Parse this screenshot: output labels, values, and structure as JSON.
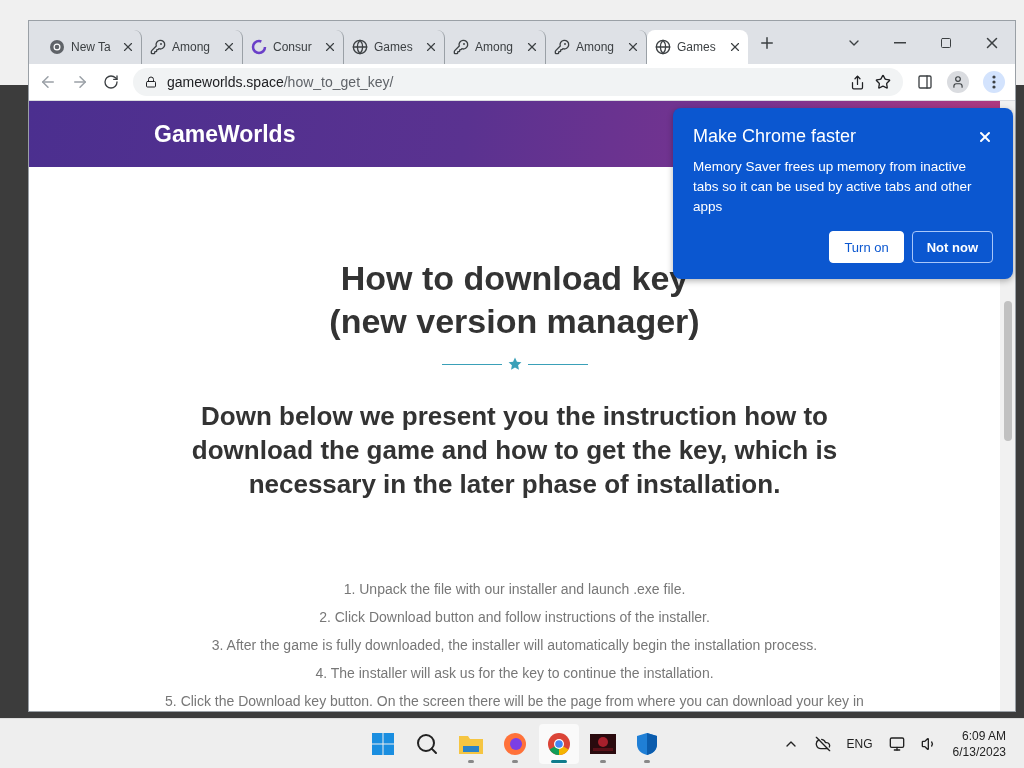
{
  "browser": {
    "tabs": [
      {
        "label": "New Ta",
        "kind": "chrome",
        "selected": false
      },
      {
        "label": "Among",
        "kind": "key",
        "selected": false
      },
      {
        "label": "Consur",
        "kind": "ring",
        "selected": false
      },
      {
        "label": "Games",
        "kind": "globe",
        "selected": false
      },
      {
        "label": "Among",
        "kind": "key",
        "selected": false
      },
      {
        "label": "Among",
        "kind": "key",
        "selected": false
      },
      {
        "label": "Games",
        "kind": "globe",
        "selected": true
      }
    ],
    "address": {
      "domain": "gameworlds.space",
      "path": "/how_to_get_key/"
    }
  },
  "site": {
    "brand": "GameWorlds",
    "title_lines": [
      "How to download key",
      "(new version manager)"
    ],
    "intro": "Down below we present you the instruction how to download the game and how to get the key, which is necessary in the later phase of installation.",
    "steps": [
      "1. Unpack the file with our installer and launch .exe file.",
      "2. Click Download button and follow instructions of the installer.",
      "3. After the game is fully downloaded, the installer will automatically begin the installation process.",
      "4. The installer will ask us for the key to continue the installation.",
      "5. Click the Download key button. On the screen there will be the page from where you can download your key in"
    ]
  },
  "popup": {
    "title": "Make Chrome faster",
    "body": "Memory Saver frees up memory from inactive tabs so it can be used by active tabs and other apps",
    "buttons": [
      {
        "label": "Turn on",
        "kind": "primary"
      },
      {
        "label": "Not now",
        "kind": "secondary"
      }
    ]
  },
  "taskbar": {
    "apps": [
      {
        "kind": "start",
        "running": false,
        "selected": false
      },
      {
        "kind": "search",
        "running": false,
        "selected": false
      },
      {
        "kind": "folder",
        "running": true,
        "selected": false
      },
      {
        "kind": "firefox",
        "running": true,
        "selected": false
      },
      {
        "kind": "chrome",
        "running": true,
        "selected": true
      },
      {
        "kind": "game",
        "running": true,
        "selected": false
      },
      {
        "kind": "shield",
        "running": true,
        "selected": false
      }
    ],
    "language": "ENG",
    "time": "6:09 AM",
    "date": "6/13/2023"
  }
}
